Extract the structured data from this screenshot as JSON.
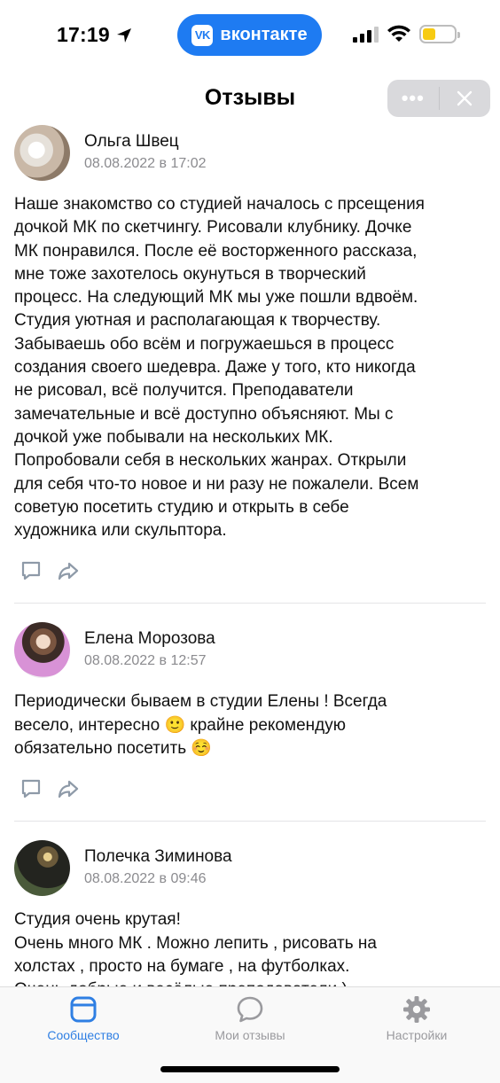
{
  "status_bar": {
    "time": "17:19",
    "app_pill": "вконтакте",
    "vk_logo": "VK",
    "battery_color": "#f7cb12"
  },
  "header": {
    "title": "Отзывы",
    "more_icon": "more-dots-icon",
    "close_icon": "close-icon"
  },
  "reviews": [
    {
      "author": "Ольга Швец",
      "date": "08.08.2022 в 17:02",
      "text": "Наше знакомство со студией началось с прсещения\nдочкой МК по скетчингу. Рисовали клубнику. Дочке\nМК понравился. После её восторженного рассказа,\nмне тоже захотелось окунуться в творческий\nпроцесс. На следующий МК мы уже пошли вдвоём.\nСтудия уютная и располагающая к творчеству.\nЗабываешь обо всём и погружаешься в процесс\nсоздания своего шедевра. Даже у того, кто никогда\nне рисовал, всё получится. Преподаватели\nзамечательные и всё доступно объясняют. Мы с\nдочкой уже побывали на нескольких МК.\nПопробовали себя в нескольких жанрах. Открыли\nдля себя что-то новое и ни разу не пожалели. Всем\nсоветую посетить студию и открыть в себе\nхудожника или скульптора."
    },
    {
      "author": "Елена Морозова",
      "date": "08.08.2022 в 12:57",
      "text": "Периодически бываем в студии Елены ! Всегда\nвесело, интересно 🙂 крайне рекомендую\nобязательно посетить ☺️"
    },
    {
      "author": "Полечка Зиминова",
      "date": "08.08.2022 в 09:46",
      "text": "Студия очень крутая!\nОчень много МК . Можно лепить , рисовать на\nхолстах , просто на бумаге , на футболках.\nОчень добрые и весёлые преподаватели )\nТам очень круто 👍🏻"
    }
  ],
  "tab_bar": {
    "tabs": [
      {
        "label": "Сообщество",
        "icon": "community-icon",
        "active": true
      },
      {
        "label": "Мои отзывы",
        "icon": "chat-bubble-icon",
        "active": false
      },
      {
        "label": "Настройки",
        "icon": "gear-icon",
        "active": false
      }
    ],
    "active_color": "#2f7fe3",
    "inactive_color": "#9a9a9e"
  }
}
